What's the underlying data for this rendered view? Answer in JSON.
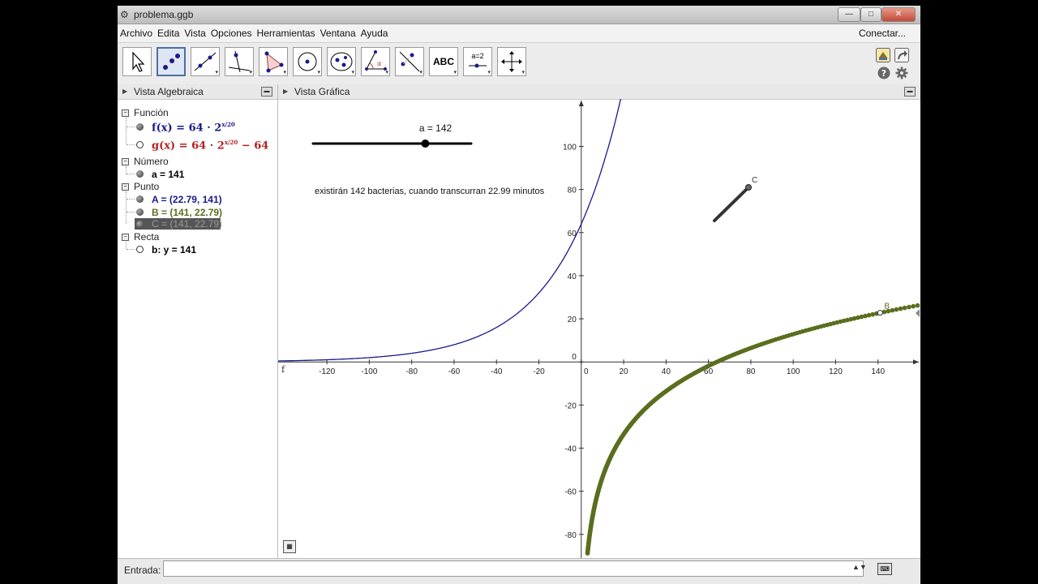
{
  "window": {
    "title": "problema.ggb",
    "minimize": "—",
    "maximize": "□",
    "close": "✕"
  },
  "menu": {
    "items": [
      "Archivo",
      "Edita",
      "Vista",
      "Opciones",
      "Herramientas",
      "Ventana",
      "Ayuda"
    ],
    "connect": "Conectar..."
  },
  "toolbar": {
    "tools": [
      {
        "name": "move-tool",
        "icon": "arrow-icon"
      },
      {
        "name": "point-tool",
        "icon": "point-icon"
      },
      {
        "name": "line-tool",
        "icon": "line-icon"
      },
      {
        "name": "perpendicular-tool",
        "icon": "perpendicular-icon"
      },
      {
        "name": "polygon-tool",
        "icon": "polygon-icon"
      },
      {
        "name": "circle-tool",
        "icon": "circle-icon"
      },
      {
        "name": "ellipse-tool",
        "icon": "ellipse-icon"
      },
      {
        "name": "angle-tool",
        "icon": "angle-icon"
      },
      {
        "name": "reflect-tool",
        "icon": "reflect-icon"
      },
      {
        "name": "text-tool",
        "icon": "text-icon",
        "label": "ABC"
      },
      {
        "name": "slider-tool",
        "icon": "slider-icon",
        "label": "a=2"
      },
      {
        "name": "move-view-tool",
        "icon": "move-view-icon"
      }
    ],
    "selected_index": 1
  },
  "algebra": {
    "title": "Vista Algebraica",
    "categories": [
      {
        "label": "Función",
        "items": [
          {
            "text": "f(x) = 64 · 2",
            "exp": "x/20",
            "visible": true,
            "color": "#1a1a8c"
          },
          {
            "text": "g(x) = 64 · 2",
            "exp": "x/20",
            "tail": " − 64",
            "visible": false,
            "color": "#b22222"
          }
        ]
      },
      {
        "label": "Número",
        "items": [
          {
            "text": "a = 141",
            "visible": true,
            "color": "#000000"
          }
        ]
      },
      {
        "label": "Punto",
        "items": [
          {
            "text": "A = (22.79, 141)",
            "visible": true,
            "color": "#1a1a8c"
          },
          {
            "text": "B = (141, 22.79)",
            "visible": true,
            "color": "#5a6e1e"
          },
          {
            "text": "C = (141, 22.79)",
            "visible": true,
            "color": "#000000",
            "highlighted": true
          }
        ]
      },
      {
        "label": "Recta",
        "items": [
          {
            "text": "b: y = 141",
            "visible": false,
            "color": "#000000"
          }
        ]
      }
    ]
  },
  "graphics": {
    "title": "Vista Gráfica",
    "slider_label": "a = 142",
    "slider_value": 142,
    "slider_min": 0,
    "slider_max": 200,
    "annotation": "existirán 142 bacterias, cuando transcurran 22.99 minutos",
    "point_c_label": "C",
    "point_b_label": "B",
    "curve_label": "f",
    "colors": {
      "f": "#1a1a8c",
      "g": "#5a6e1e",
      "axis": "#333333"
    }
  },
  "chart_data": {
    "type": "line",
    "xlim": [
      -143,
      160
    ],
    "ylim": [
      -91,
      122
    ],
    "x_ticks": [
      -120,
      -100,
      -80,
      -60,
      -40,
      -20,
      0,
      20,
      40,
      60,
      80,
      100,
      120,
      140
    ],
    "y_ticks": [
      -80,
      -60,
      -40,
      -20,
      0,
      20,
      40,
      60,
      80,
      100
    ],
    "grid": false,
    "series": [
      {
        "name": "f",
        "formula": "64*2^(x/20)",
        "color": "#1a1a8c"
      },
      {
        "name": "g",
        "formula": "20*log2(x/64)",
        "color": "#5a6e1e"
      }
    ],
    "points": [
      {
        "name": "B",
        "x": 141,
        "y": 22.79
      }
    ]
  },
  "input": {
    "label": "Entrada:",
    "value": "",
    "spin": "▲▼",
    "keyboard": "⌨"
  }
}
